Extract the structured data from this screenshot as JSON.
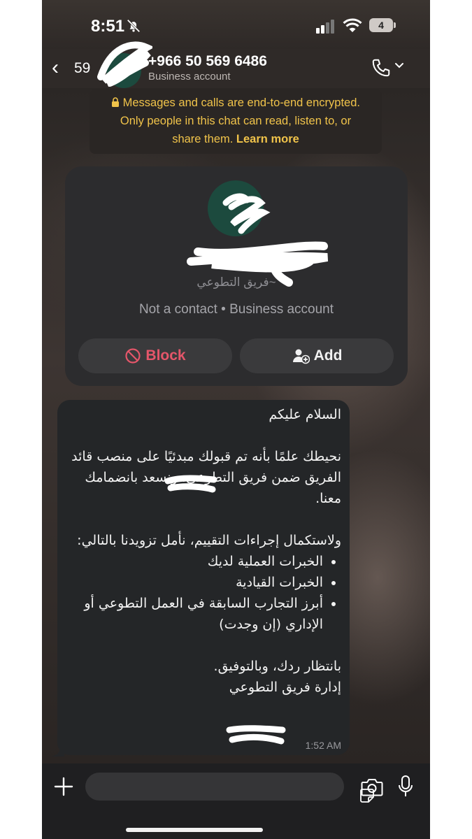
{
  "status_bar": {
    "time": "8:51",
    "battery": "4"
  },
  "header": {
    "back_count": "59",
    "phone": "+966 50 569 6486",
    "subtitle": "Business account"
  },
  "encryption": {
    "line1": "Messages and calls are end-to-end encrypted.",
    "line2": "Only people in this chat can read, listen to, or",
    "line3": "share them.",
    "learn_more": "Learn more"
  },
  "contact_card": {
    "name": "~فريق التطوعي",
    "status": "Not a contact • Business account",
    "block_label": "Block",
    "add_label": "Add"
  },
  "message": {
    "greeting": "السلام عليكم",
    "para1": "نحيطك علمًا بأنه تم قبولك مبدئيًا على منصب قائد الفريق ضمن فريق التطوعي، ونسعد بانضمامك معنا.",
    "para2": "ولاستكمال إجراءات التقييم، نأمل تزويدنا بالتالي:",
    "bullets": [
      "الخبرات العملية لديك",
      "الخبرات القيادية",
      "أبرز التجارب السابقة في العمل التطوعي أو الإداري (إن وجدت)"
    ],
    "closing": "بانتظار ردك، وبالتوفيق.",
    "signature": "إدارة فريق التطوعي",
    "time": "1:52 AM"
  },
  "colors": {
    "encryption_text": "#f0c34a",
    "block_red": "#e5566a",
    "avatar_green": "#1c4a3e"
  }
}
